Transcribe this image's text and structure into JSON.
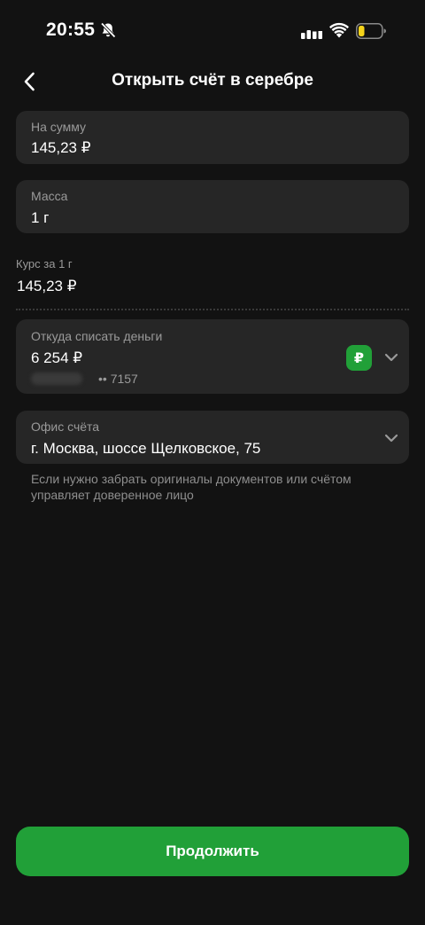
{
  "status_bar": {
    "time": "20:55",
    "icons": [
      "bell-off-icon",
      "signal-icon",
      "wifi-icon",
      "battery-icon"
    ]
  },
  "header": {
    "title": "Открыть счёт в серебре",
    "back_icon": "chevron-left-icon"
  },
  "form": {
    "amount": {
      "label": "На сумму",
      "value": "145,23 ₽"
    },
    "mass": {
      "label": "Масса",
      "value": "1 г"
    },
    "rate": {
      "label": "Курс за 1 г",
      "value": "145,23 ₽"
    },
    "source": {
      "label": "Откуда списать деньги",
      "value": "6 254 ₽",
      "account_number": "•• 7157",
      "currency_badge": "₽"
    },
    "office": {
      "label": "Офис счёта",
      "value": "г. Москва, шоссе Щелковское, 75",
      "hint": "Если нужно забрать оригиналы документов или счётом управляет доверенное лицо"
    }
  },
  "actions": {
    "continue_label": "Продолжить"
  },
  "colors": {
    "background": "#121212",
    "card": "#262626",
    "accent_green": "#21a038",
    "muted_text": "#9a9a9a"
  }
}
